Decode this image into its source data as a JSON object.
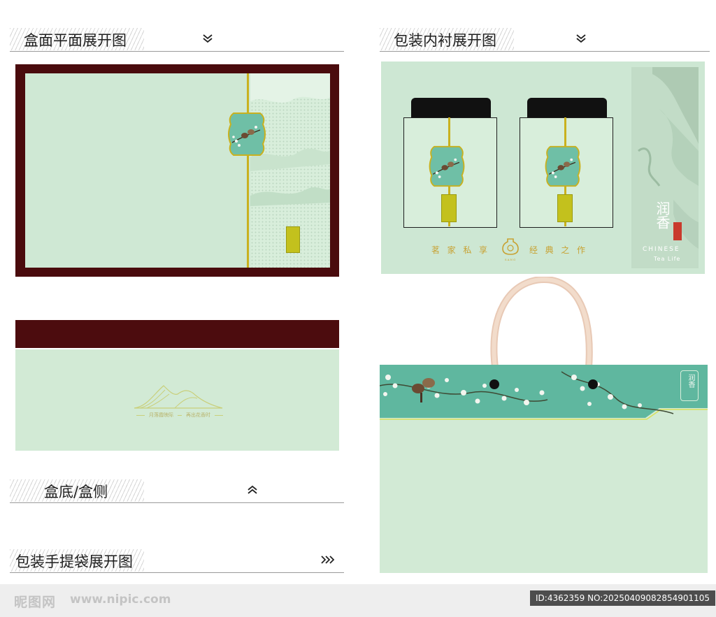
{
  "sections": {
    "lid": {
      "title": "盒面平面展开图",
      "chevron": "chevron-double-down-icon"
    },
    "liner": {
      "title": "包装内衬展开图",
      "chevron": "chevron-double-down-icon"
    },
    "bottom": {
      "title": "盒底/盒侧",
      "chevron": "chevron-double-up-icon"
    },
    "bag": {
      "title": "包装手提袋展开图",
      "chevron": "chevron-double-right-icon"
    }
  },
  "bottom_panel": {
    "slogan_left": "月落霞映际",
    "slogan_right": "再出花香时"
  },
  "liner": {
    "tagline_left": [
      "茗",
      "家",
      "私",
      "享"
    ],
    "tagline_right": [
      "经",
      "典",
      "之",
      "作"
    ],
    "emblem_label": "SANG",
    "side_brand": "润香",
    "side_en_1": "CHINESE",
    "side_en_2": "Tea Life"
  },
  "bag": {
    "badge_text": "润香"
  },
  "footer": {
    "logo": "昵图网",
    "url": "www.nipic.com",
    "id_text": "ID:4362359 NO:20250409082854901105"
  },
  "colors": {
    "frame_maroon": "#4a0b0d",
    "mint": "#cfe8d4",
    "teal": "#5fb79f",
    "gold": "#c9b11f"
  }
}
